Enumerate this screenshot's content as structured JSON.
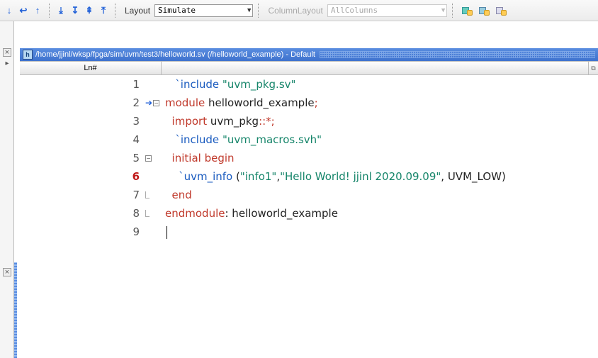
{
  "toolbar": {
    "layout_label": "Layout",
    "layout_value": "Simulate",
    "columnlayout_label": "ColumnLayout",
    "columnlayout_value": "AllColumns"
  },
  "title": {
    "path": "/home/jjinl/wksp/fpga/sim/uvm/test3/helloworld.sv (/helloworld_example) - Default"
  },
  "header": {
    "ln": "Ln#"
  },
  "code": {
    "lines": [
      {
        "n": "1",
        "segments": [
          {
            "cls": "kw-blue",
            "txt": "   `include "
          },
          {
            "cls": "kw-green",
            "txt": "\"uvm_pkg.sv\""
          }
        ]
      },
      {
        "n": "2",
        "markers": [
          "arrow",
          "minus"
        ],
        "segments": [
          {
            "cls": "kw-red",
            "txt": "module"
          },
          {
            "cls": "plain",
            "txt": " helloworld_example"
          },
          {
            "cls": "kw-red",
            "txt": ";"
          }
        ]
      },
      {
        "n": "3",
        "segments": [
          {
            "cls": "plain",
            "txt": "  "
          },
          {
            "cls": "kw-red",
            "txt": "import"
          },
          {
            "cls": "plain",
            "txt": " uvm_pkg"
          },
          {
            "cls": "kw-red",
            "txt": "::*;"
          }
        ]
      },
      {
        "n": "4",
        "segments": [
          {
            "cls": "plain",
            "txt": "   "
          },
          {
            "cls": "kw-blue",
            "txt": "`include "
          },
          {
            "cls": "kw-green",
            "txt": "\"uvm_macros.svh\""
          }
        ]
      },
      {
        "n": "5",
        "markers": [
          "minus"
        ],
        "segments": [
          {
            "cls": "plain",
            "txt": "  "
          },
          {
            "cls": "kw-red",
            "txt": "initial begin"
          }
        ]
      },
      {
        "n": "6",
        "bp": true,
        "segments": [
          {
            "cls": "plain",
            "txt": "    "
          },
          {
            "cls": "kw-blue",
            "txt": "`uvm_info "
          },
          {
            "cls": "plain",
            "txt": "("
          },
          {
            "cls": "kw-green",
            "txt": "\"info1\""
          },
          {
            "cls": "plain",
            "txt": ","
          },
          {
            "cls": "kw-green",
            "txt": "\"Hello World! jjinl 2020.09.09\""
          },
          {
            "cls": "plain",
            "txt": ", UVM_LOW)"
          }
        ]
      },
      {
        "n": "7",
        "markers": [
          "end"
        ],
        "segments": [
          {
            "cls": "plain",
            "txt": "  "
          },
          {
            "cls": "kw-red",
            "txt": "end"
          }
        ]
      },
      {
        "n": "8",
        "markers": [
          "end"
        ],
        "segments": [
          {
            "cls": "kw-red",
            "txt": "endmodule"
          },
          {
            "cls": "plain",
            "txt": ": helloworld_example"
          }
        ]
      },
      {
        "n": "9",
        "cursor": true,
        "segments": []
      }
    ]
  }
}
